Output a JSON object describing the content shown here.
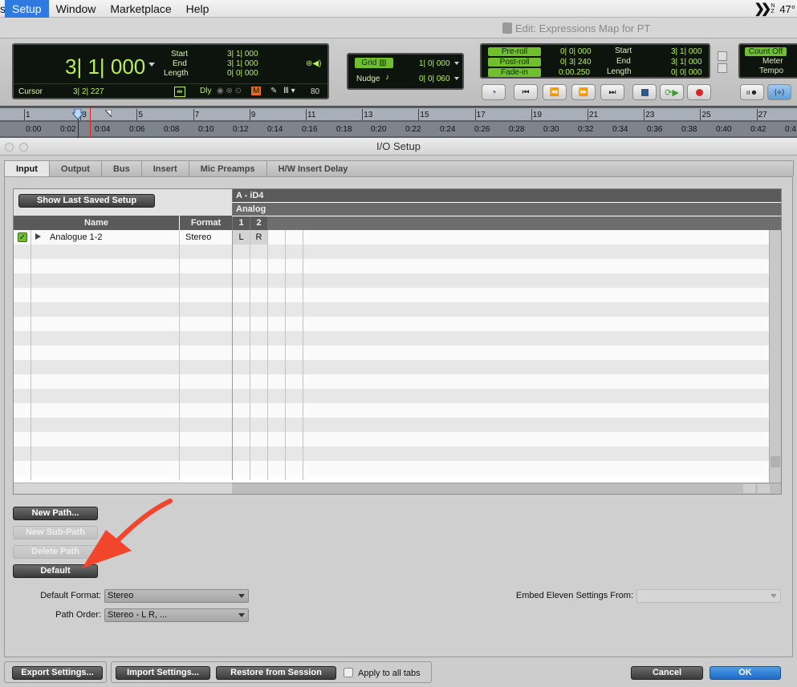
{
  "menubar": {
    "lead": "s",
    "items": [
      "Setup",
      "Window",
      "Marketplace",
      "Help"
    ],
    "active": "Setup",
    "temp": "47°"
  },
  "edit_window": {
    "title": "Edit: Expressions Map for PT"
  },
  "counter": {
    "main": "3| 1| 000",
    "start_label": "Start",
    "start": "3| 1| 000",
    "end_label": "End",
    "end": "3| 1| 000",
    "length_label": "Length",
    "length": "0| 0| 000",
    "cursor_label": "Cursor",
    "cursor": "3| 2| 227",
    "dly_label": "Dly",
    "m_label": "M",
    "value_80": "80"
  },
  "grid_nudge": {
    "grid_label": "Grid",
    "grid_value": "1| 0| 000",
    "nudge_label": "Nudge",
    "nudge_value": "0| 0| 060"
  },
  "preroll": {
    "preroll_label": "Pre-roll",
    "preroll": "0| 0| 000",
    "postroll_label": "Post-roll",
    "postroll": "0| 3| 240",
    "fadein_label": "Fade-in",
    "fadein": "0:00.250",
    "start_label": "Start",
    "start": "3| 1| 000",
    "end_label": "End",
    "end": "3| 1| 000",
    "length_label": "Length",
    "length": "0| 0| 000"
  },
  "count": {
    "count_off": "Count Off",
    "meter": "Meter",
    "tempo": "Tempo"
  },
  "ruler": {
    "bars": [
      "1",
      "3",
      "5",
      "7",
      "9",
      "11",
      "13",
      "15",
      "17",
      "19",
      "21",
      "23",
      "25",
      "27"
    ],
    "times": [
      "0:00",
      "0:02",
      "0:04",
      "0:06",
      "0:08",
      "0:10",
      "0:12",
      "0:14",
      "0:16",
      "0:18",
      "0:20",
      "0:22",
      "0:24",
      "0:26",
      "0:28",
      "0:30",
      "0:32",
      "0:34",
      "0:36",
      "0:38",
      "0:40",
      "0:42",
      "0:4"
    ]
  },
  "io": {
    "title": "I/O Setup",
    "tabs": [
      "Input",
      "Output",
      "Bus",
      "Insert",
      "Mic Preamps",
      "H/W Insert Delay"
    ],
    "active_tab": "Input",
    "show_last_saved": "Show Last Saved Setup",
    "col_name": "Name",
    "col_format": "Format",
    "device": "A - iD4",
    "analog": "Analog",
    "ch1": "1",
    "ch2": "2",
    "row_name": "Analogue 1-2",
    "row_format": "Stereo",
    "row_l": "L",
    "row_r": "R",
    "new_path": "New Path...",
    "new_sub_path": "New Sub-Path",
    "delete_path": "Delete Path",
    "default": "Default",
    "default_format_label": "Default Format:",
    "default_format": "Stereo",
    "path_order_label": "Path Order:",
    "path_order": "Stereo - L R, ...",
    "embed_label": "Embed Eleven Settings From:",
    "embed_value": "",
    "export": "Export Settings...",
    "import": "Import Settings...",
    "restore": "Restore from Session",
    "apply_all": "Apply to all tabs",
    "cancel": "Cancel",
    "ok": "OK"
  },
  "colors": {
    "lcd_green": "#b8ef5a",
    "accent_blue": "#2f7ae0",
    "annotation_arrow": "#f1452c"
  }
}
